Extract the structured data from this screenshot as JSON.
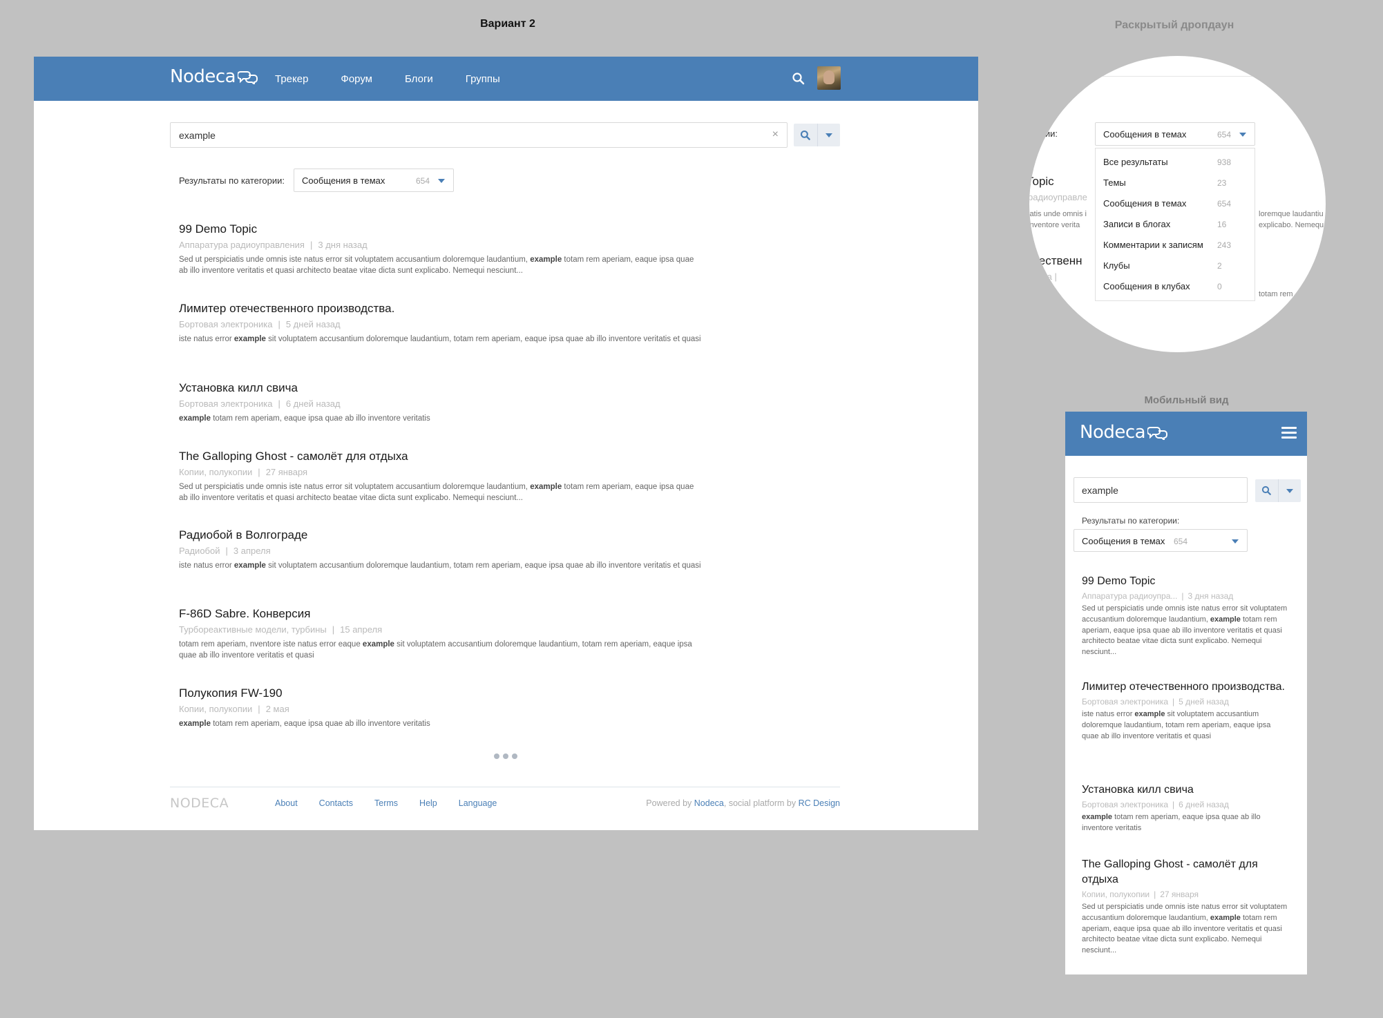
{
  "captions": {
    "variant": "Вариант 2",
    "dropdown": "Раскрытый дропдаун",
    "mobile": "Мобильный вид"
  },
  "header": {
    "logo": "Nodeca",
    "nav": [
      "Трекер",
      "Форум",
      "Блоги",
      "Группы"
    ]
  },
  "search": {
    "value": "example",
    "clear": "×"
  },
  "category": {
    "label": "Результаты по категории:",
    "selected": "Сообщения в темах",
    "count": "654"
  },
  "results": [
    {
      "title": "99 Demo Topic",
      "section": "Аппаратура радиоуправления",
      "date": "3 дня назад",
      "pre": "Sed ut perspiciatis unde omnis iste natus error sit voluptatem accusantium doloremque laudantium, ",
      "hl": "example",
      "post": " totam rem aperiam, eaque ipsa quae ab illo inventore veritatis et quasi architecto beatae vitae dicta sunt explicabo. Nemequi nesciunt..."
    },
    {
      "title": "Лимитер отечественного производства.",
      "section": "Бортовая электроника",
      "date": "5 дней назад",
      "pre": "iste natus error ",
      "hl": "example",
      "post": " sit voluptatem accusantium doloremque laudantium,  totam rem aperiam, eaque ipsa quae ab illo inventore veritatis et quasi"
    },
    {
      "title": "Установка килл свича",
      "section": "Бортовая электроника",
      "date": "6 дней назад",
      "pre": "",
      "hl": "example",
      "post": " totam rem aperiam, eaque ipsa quae ab illo inventore veritatis"
    },
    {
      "title": "The Galloping Ghost - самолёт для отдыха",
      "section": "Копии, полукопии",
      "date": "27 января",
      "pre": "Sed ut perspiciatis unde omnis iste natus error sit voluptatem accusantium doloremque laudantium, ",
      "hl": "example",
      "post": " totam rem aperiam, eaque ipsa quae ab illo inventore veritatis et quasi architecto beatae vitae dicta sunt explicabo. Nemequi nesciunt..."
    },
    {
      "title": "Радиобой в Волгограде",
      "section": "Радиобой",
      "date": "3 апреля",
      "pre": "iste natus error ",
      "hl": "example",
      "post": " sit voluptatem accusantium doloremque laudantium,  totam rem aperiam, eaque ipsa quae ab illo inventore veritatis et quasi"
    },
    {
      "title": "F-86D Sabre. Конверсия",
      "section": "Турбореактивные модели, турбины",
      "date": "15 апреля",
      "pre": "totam rem aperiam,  nventore iste natus error eaque ",
      "hl": "example",
      "post": " sit voluptatem accusantium doloremque laudantium,  totam rem aperiam, eaque ipsa quae ab illo inventore veritatis et quasi"
    },
    {
      "title": "Полукопия FW-190",
      "section": "Копии, полукопии",
      "date": "2 мая",
      "pre": "",
      "hl": "example",
      "post": " totam rem aperiam, eaque ipsa quae ab illo inventore veritatis"
    }
  ],
  "footer": {
    "logo": "NODECA",
    "links": [
      "About",
      "Contacts",
      "Terms",
      "Help",
      "Language"
    ],
    "powered_pre": "Powered by ",
    "powered_link": "Nodeca",
    "powered_mid": ", social platform by ",
    "powered_link2": "RC Design"
  },
  "dropdown": {
    "label_partial": "атегории:",
    "items": [
      {
        "label": "Все результаты",
        "count": "938"
      },
      {
        "label": "Темы",
        "count": "23"
      },
      {
        "label": "Сообщения в темах",
        "count": "654"
      },
      {
        "label": "Записи в блогах",
        "count": "16"
      },
      {
        "label": "Комментарии к записям",
        "count": "243"
      },
      {
        "label": "Клубы",
        "count": "2"
      },
      {
        "label": "Сообщения в клубах",
        "count": "0"
      }
    ],
    "bg_title1": "Topic",
    "bg_meta1": "радиоуправле",
    "bg_snip1a": "iatis unde omnis i",
    "bg_snip1b": "inventore verita",
    "bg_right1a": "loremque laudantiu",
    "bg_right1b": "explicabo. Nemequ",
    "bg_title2": "ечественн",
    "bg_meta2": "оника  |",
    "bg_snip2a": "e sit volu",
    "bg_right2": "totam rem"
  },
  "mobile": {
    "search_value": "example",
    "cat_label": "Результаты по категории:",
    "selected": "Сообщения в темах",
    "count": "654",
    "results": [
      {
        "title": "99 Demo Topic",
        "section": "Аппаратура радиоупра...",
        "date": "3 дня назад",
        "pre": "Sed ut perspiciatis unde omnis iste natus error sit voluptatem accusantium doloremque laudantium, ",
        "hl": "example",
        "post": " totam rem aperiam, eaque ipsa quae ab illo inventore veritatis et quasi architecto beatae vitae dicta sunt explicabo. Nemequi nesciunt..."
      },
      {
        "title": "Лимитер отечественного производства.",
        "section": "Бортовая электроника",
        "date": "5 дней назад",
        "pre": "iste natus error ",
        "hl": "example",
        "post": " sit voluptatem accusantium doloremque laudantium,  totam rem aperiam, eaque ipsa quae ab illo inventore veritatis et quasi"
      },
      {
        "title": "Установка килл свича",
        "section": "Бортовая электроника",
        "date": "6 дней назад",
        "pre": "",
        "hl": "example",
        "post": " totam rem aperiam, eaque ipsa quae ab illo inventore veritatis"
      },
      {
        "title": "The Galloping Ghost - самолёт для отдыха",
        "section": "Копии, полукопии",
        "date": "27 января",
        "pre": "Sed ut perspiciatis unde omnis iste natus error sit voluptatem accusantium doloremque laudantium, ",
        "hl": "example",
        "post": " totam rem aperiam, eaque ipsa quae ab illo inventore veritatis et quasi architecto beatae vitae dicta sunt explicabo. Nemequi nesciunt..."
      }
    ]
  },
  "colors": {
    "brand": "#4a7fb6",
    "canvas": "#c1c1c1",
    "muted": "#b9b9b9"
  },
  "icons": [
    "search-icon",
    "chevron-down-icon",
    "close-icon",
    "hamburger-icon",
    "logo-bubbles-icon"
  ]
}
